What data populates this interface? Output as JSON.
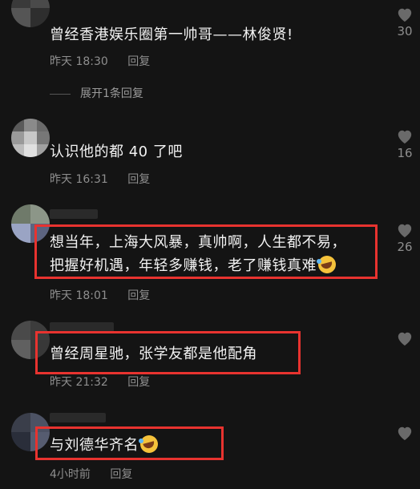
{
  "comments": [
    {
      "text": "曾经香港娱乐圈第一帅哥——林俊贤!",
      "time": "昨天 18:30",
      "reply": "回复",
      "likes": "30",
      "expand": "展开1条回复"
    },
    {
      "text": "认识他的都 40 了吧",
      "time": "昨天 16:31",
      "reply": "回复",
      "likes": "16"
    },
    {
      "text_line1": "想当年，上海大风暴，真帅啊，人生都不易，",
      "text_line2": "把握好机遇，年轻多赚钱，老了赚钱真难",
      "emoji": "rolling-on-floor-laughing",
      "time": "昨天 18:01",
      "reply": "回复",
      "likes": "26"
    },
    {
      "text": "曾经周星驰，张学友都是他配角",
      "time": "昨天 21:32",
      "reply": "回复",
      "likes": ""
    },
    {
      "text": "与刘德华齐名",
      "emoji": "rolling-on-floor-laughing",
      "time": "4小时前",
      "reply": "回复",
      "likes": ""
    }
  ],
  "colors": {
    "background": "#141414",
    "highlight_border": "#e8332f",
    "meta_text": "#8e8e8e",
    "main_text": "#f2f2f2"
  },
  "icons": [
    "heart-icon",
    "laughing-emoji"
  ]
}
